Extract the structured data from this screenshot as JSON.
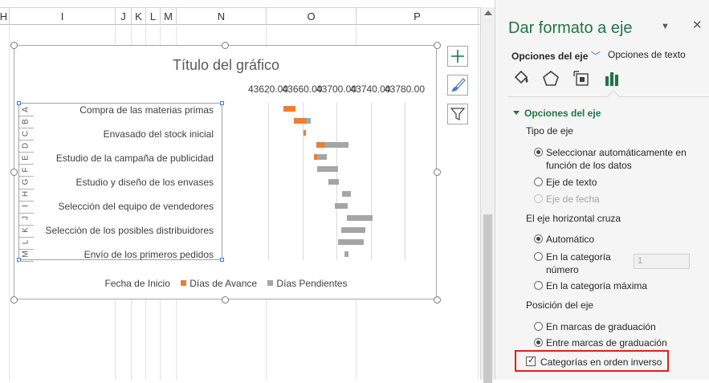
{
  "spreadsheet": {
    "columns": [
      {
        "label": "H",
        "width": 14
      },
      {
        "label": "I",
        "width": 132
      },
      {
        "label": "J",
        "width": 20
      },
      {
        "label": "K",
        "width": 18
      },
      {
        "label": "L",
        "width": 18
      },
      {
        "label": "M",
        "width": 20
      },
      {
        "label": "N",
        "width": 112
      },
      {
        "label": "O",
        "width": 112
      },
      {
        "label": "P",
        "width": 152
      }
    ]
  },
  "chart": {
    "title": "Título del gráfico",
    "legend": [
      {
        "label": "Fecha de Inicio",
        "color": ""
      },
      {
        "label": "Días de Avance",
        "color": "#ed7d31"
      },
      {
        "label": "Días Pendientes",
        "color": "#a5a5a5"
      }
    ],
    "buttons": [
      {
        "name": "chart-elements-button",
        "glyph": "+"
      },
      {
        "name": "chart-styles-button",
        "glyph": "brush"
      },
      {
        "name": "chart-filters-button",
        "glyph": "filter"
      }
    ]
  },
  "chart_data": {
    "type": "bar",
    "orientation": "horizontal",
    "stacked": true,
    "title": "Título del gráfico",
    "x_axis": {
      "position": "top",
      "ticks": [
        "43620.00",
        "43660.00",
        "43700.00",
        "43740.00",
        "43780.00"
      ],
      "xlim": [
        43620,
        43780
      ],
      "gridlines": true
    },
    "category_letters": [
      "A",
      "B",
      "C",
      "D",
      "E",
      "F",
      "G",
      "H",
      "I",
      "J",
      "K",
      "L",
      "M"
    ],
    "category_labels": [
      "Compra de las materias primas",
      "Envasado del stock inicial",
      "Estudio de la campaña de publicidad",
      "Estudio y diseño de los envases",
      "Selección del equipo de vendedores",
      "Selección de los posibles distribuidores",
      "Envío de los primeros pedidos"
    ],
    "series": [
      {
        "name": "Fecha de Inicio",
        "color": "none",
        "values": [
          43638,
          43650,
          43661,
          43676,
          43674,
          43677,
          43691,
          43707,
          43698,
          43712,
          43706,
          43702,
          43709
        ]
      },
      {
        "name": "Días de Avance",
        "color": "#ed7d31",
        "values": [
          14,
          14,
          3,
          10,
          3,
          0,
          0,
          0,
          0,
          0,
          0,
          0,
          0
        ]
      },
      {
        "name": "Días Pendientes",
        "color": "#a5a5a5",
        "values": [
          0,
          6,
          0,
          28,
          12,
          25,
          12,
          10,
          15,
          30,
          28,
          30,
          5
        ]
      }
    ],
    "legend_position": "bottom"
  },
  "panel": {
    "title": "Dar formato a eje",
    "tabs": {
      "axis_options": "Opciones del eje",
      "text_options": "Opciones de texto"
    },
    "icons": [
      "fill-line-icon",
      "effects-icon",
      "size-properties-icon",
      "axis-options-icon"
    ],
    "section": "Opciones del eje",
    "axis_type": {
      "label": "Tipo de eje",
      "options": [
        {
          "text": "Seleccionar automáticamente en función de los datos",
          "checked": true,
          "disabled": false
        },
        {
          "text": "Eje de texto",
          "checked": false,
          "disabled": false
        },
        {
          "text": "Eje de fecha",
          "checked": false,
          "disabled": true
        }
      ]
    },
    "crosses": {
      "label": "El eje horizontal cruza",
      "options": [
        {
          "text": "Automático",
          "checked": true
        },
        {
          "text": "En la categoría número",
          "checked": false
        },
        {
          "text": "En la categoría máxima",
          "checked": false
        }
      ],
      "category_number": "1"
    },
    "position": {
      "label": "Posición del eje",
      "options": [
        {
          "text": "En marcas de graduación",
          "checked": false
        },
        {
          "text": "Entre marcas de graduación",
          "checked": true
        }
      ]
    },
    "reverse_categories": {
      "text": "Categorías en orden inverso",
      "checked": true
    }
  }
}
